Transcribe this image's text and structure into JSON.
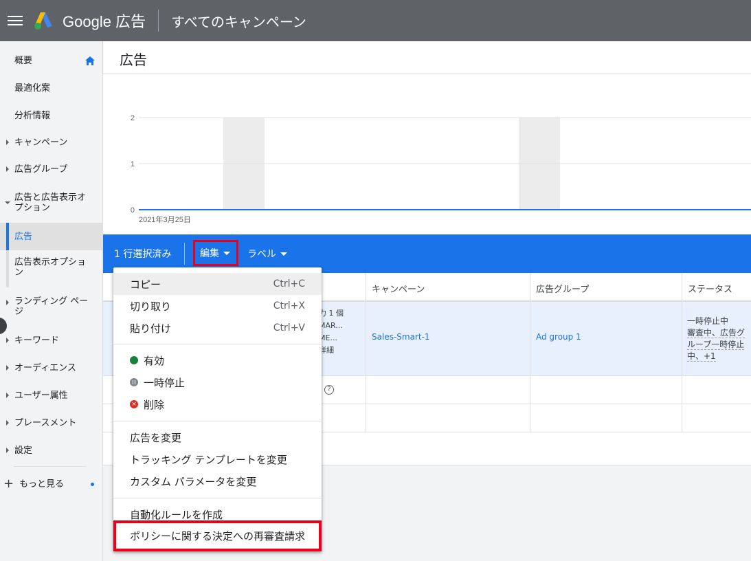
{
  "header": {
    "brand": "Google 広告",
    "campaign_scope": "すべてのキャンペーン"
  },
  "sidebar": {
    "items": [
      {
        "label": "概要"
      },
      {
        "label": "最適化案"
      },
      {
        "label": "分析情報"
      },
      {
        "label": "キャンペーン"
      },
      {
        "label": "広告グループ"
      },
      {
        "label": "広告と広告表示オプション"
      },
      {
        "label": "広告"
      },
      {
        "label": "広告表示オプション"
      },
      {
        "label": "ランディング ページ"
      },
      {
        "label": "キーワード"
      },
      {
        "label": "オーディエンス"
      },
      {
        "label": "ユーザー属性"
      },
      {
        "label": "プレースメント"
      },
      {
        "label": "設定"
      }
    ],
    "more": "もっと見る"
  },
  "page": {
    "title": "広告"
  },
  "chart_data": {
    "type": "line",
    "x": [
      "2021年3月25日"
    ],
    "series": [
      {
        "values": [
          0,
          0
        ]
      }
    ],
    "yticks": [
      "2",
      "1",
      "0"
    ],
    "ylim": [
      0,
      2
    ],
    "x_tick_label": "2021年3月25日",
    "grid": true,
    "colors": {
      "line": "#1a73e8",
      "band": "#ececec"
    }
  },
  "actionbar": {
    "selected": "1 行選択済み",
    "edit": "編集",
    "label": "ラベル"
  },
  "table": {
    "columns": {
      "campaign": "キャンペーン",
      "adgroup": "広告グループ",
      "status": "ステータス"
    },
    "row1": {
      "ad_lines": [
        "力 1 個",
        "MAR...",
        "ME...",
        "詳細"
      ],
      "campaign": "Sales-Smart-1",
      "adgroup": "Ad group 1",
      "status_lines": [
        "一時停止中",
        "審査中、広告グ",
        "ループ一時停止",
        "中、+1"
      ]
    },
    "help_glyph": "?"
  },
  "menu": {
    "copy": "コピー",
    "copy_kbd": "Ctrl+C",
    "cut": "切り取り",
    "cut_kbd": "Ctrl+X",
    "paste": "貼り付け",
    "paste_kbd": "Ctrl+V",
    "enable": "有効",
    "pause": "一時停止",
    "remove": "削除",
    "change_ad": "広告を変更",
    "change_tracking": "トラッキング テンプレートを変更",
    "change_params": "カスタム パラメータを変更",
    "create_rule": "自動化ルールを作成",
    "appeal": "ポリシーに関する決定への再審査請求"
  },
  "colors": {
    "header": "#5f6368",
    "accent": "#1a73e8",
    "highlight": "#e8001c"
  }
}
